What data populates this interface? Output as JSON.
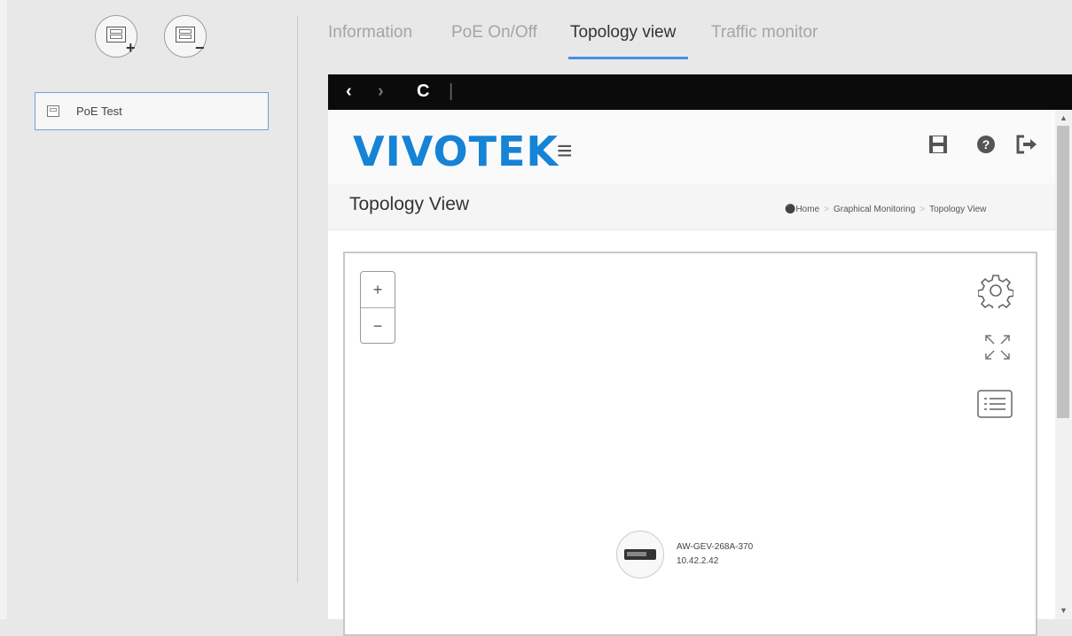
{
  "left_panel": {
    "add_sign": "+",
    "remove_sign": "−",
    "devices": [
      {
        "label": "PoE Test"
      }
    ]
  },
  "tabs": [
    {
      "label": "Information"
    },
    {
      "label": "PoE On/Off"
    },
    {
      "label": "Topology view",
      "active": true
    },
    {
      "label": "Traffic monitor"
    }
  ],
  "browser": {
    "nav": {
      "back": "‹",
      "forward": "›",
      "refresh": "C",
      "sep": "|"
    },
    "logo": "VIVOTEK",
    "page_title": "Topology View",
    "breadcrumbs": [
      "Home",
      "Graphical Monitoring",
      "Topology View"
    ],
    "zoom_in": "+",
    "zoom_out": "−",
    "node": {
      "name": "AW-GEV-268A-370",
      "ip": "10.42.2.42"
    }
  },
  "colors": {
    "accent": "#4a8ee8",
    "logo": "#1583d6"
  }
}
